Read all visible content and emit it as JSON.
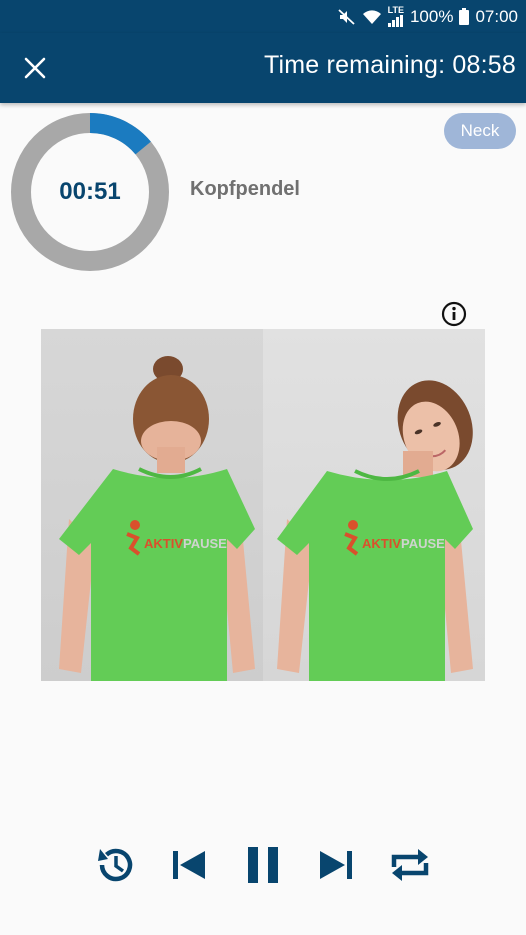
{
  "status_bar": {
    "battery": "100%",
    "clock": "07:00",
    "network": "LTE",
    "icons": [
      "mute-icon",
      "wifi-icon",
      "signal-icon",
      "battery-icon"
    ]
  },
  "header": {
    "close_icon": "close-icon",
    "time_remaining": "Time remaining: 08:58"
  },
  "timer": {
    "elapsed": "00:51",
    "progress": 0.14
  },
  "exercise": {
    "name": "Kopfpendel",
    "category": "Neck",
    "info_icon": "info-icon"
  },
  "shirt_logo": "AKTIVPAUSE",
  "controls": [
    "replay-icon",
    "previous-icon",
    "pause-icon",
    "next-icon",
    "repeat-icon"
  ],
  "colors": {
    "primary": "#08456e",
    "progress_accent": "#1b7bc0",
    "ring_track": "#a8a8a8",
    "chip": "#9fb6d8",
    "shirt": "#63cc56"
  }
}
